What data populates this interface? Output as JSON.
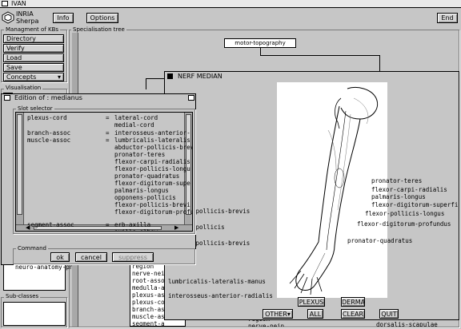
{
  "app": {
    "title": "IVAN",
    "logo_line1": "INRIA",
    "logo_line2": "Sherpa"
  },
  "toolbar": {
    "info": "Info",
    "options": "Options",
    "end": "End"
  },
  "kb_panel": {
    "title": "Managment of KBs",
    "items": [
      "Directory",
      "Verify",
      "Load",
      "Save",
      "Concepts"
    ]
  },
  "visualisation": {
    "title": "Visualisation",
    "stubs": [
      "Re",
      "Re",
      "Re",
      "Ge",
      "Se",
      "Re",
      "Qu",
      "In",
      "Ca",
      "In",
      "Cl",
      "Se",
      "ne",
      "Su",
      "ma"
    ]
  },
  "sub_concepts": {
    "value": "neuro-anatomy-pns"
  },
  "sub_classes": {
    "title": "Sub-classes"
  },
  "tree": {
    "title": "Specialisation tree",
    "root_node": "motor-topography"
  },
  "nerf_window": {
    "title": "NERF MEDIAN",
    "left_labels": [
      "-pollicis-brevis",
      "-pollicis",
      "-pollicis-brevis",
      "lumbricalis-lateralis-manus",
      "interosseus-anterior-radialis"
    ],
    "right_labels": [
      "pronator-teres",
      "flexor-carpi-radialis",
      "palmaris-longus",
      "flexor-digitorum-superfic",
      "flexor-pollicis-longus",
      "flexor-digitorum-profundus",
      "pronator-quadratus"
    ],
    "buttons": {
      "plexus": "PLEXUS",
      "derma": "DERMA",
      "other": "OTHER▾",
      "all": "ALL",
      "clear": "CLEAR",
      "quit": "QUIT"
    }
  },
  "edition_window": {
    "title": "Edition of : medianus",
    "slot_selector_title": "Slot selector",
    "command_title": "Command",
    "slots": [
      {
        "name": "plexus-cord",
        "values": [
          "lateral-cord",
          "medial-cord"
        ]
      },
      {
        "name": "branch-assoc",
        "values": [
          "interosseus-anterior-"
        ]
      },
      {
        "name": "muscle-assoc",
        "values": [
          "lumbricalis-lateralis",
          "abductor-pollicis-brev",
          "pronator-teres",
          "flexor-carpi-radialis",
          "flexor-pollicis-longu",
          "pronator-quadratus",
          "flexor-digitorum-supe",
          "palmaris-longus",
          "opponens-pollicis",
          "flexor-pollicis-brevi",
          "flexor-digitorum-profu"
        ]
      },
      {
        "name": "segment-assoc",
        "values": [
          "erb-axilla",
          "axilla-elbow",
          "elbow-wrist",
          "wrist-palma",
          "wrist-pop"
        ]
      }
    ],
    "buttons": {
      "ok": "ok",
      "cancel": "cancel",
      "suppress": "suppress"
    }
  },
  "bottom_list": [
    "region",
    "nerve-nei",
    "root-asso",
    "medulla-a",
    "plexus-as",
    "plexus-co",
    "branch-as",
    "muscle-as",
    "segment-a",
    "sensory-segment"
  ],
  "bottom_right_list": [
    "region",
    "nerve-nein",
    "cumulus-sup",
    "dorsalis-scapulae"
  ],
  "colors": {
    "bg": "#c6c6c6",
    "button": "#d4d4d4"
  }
}
